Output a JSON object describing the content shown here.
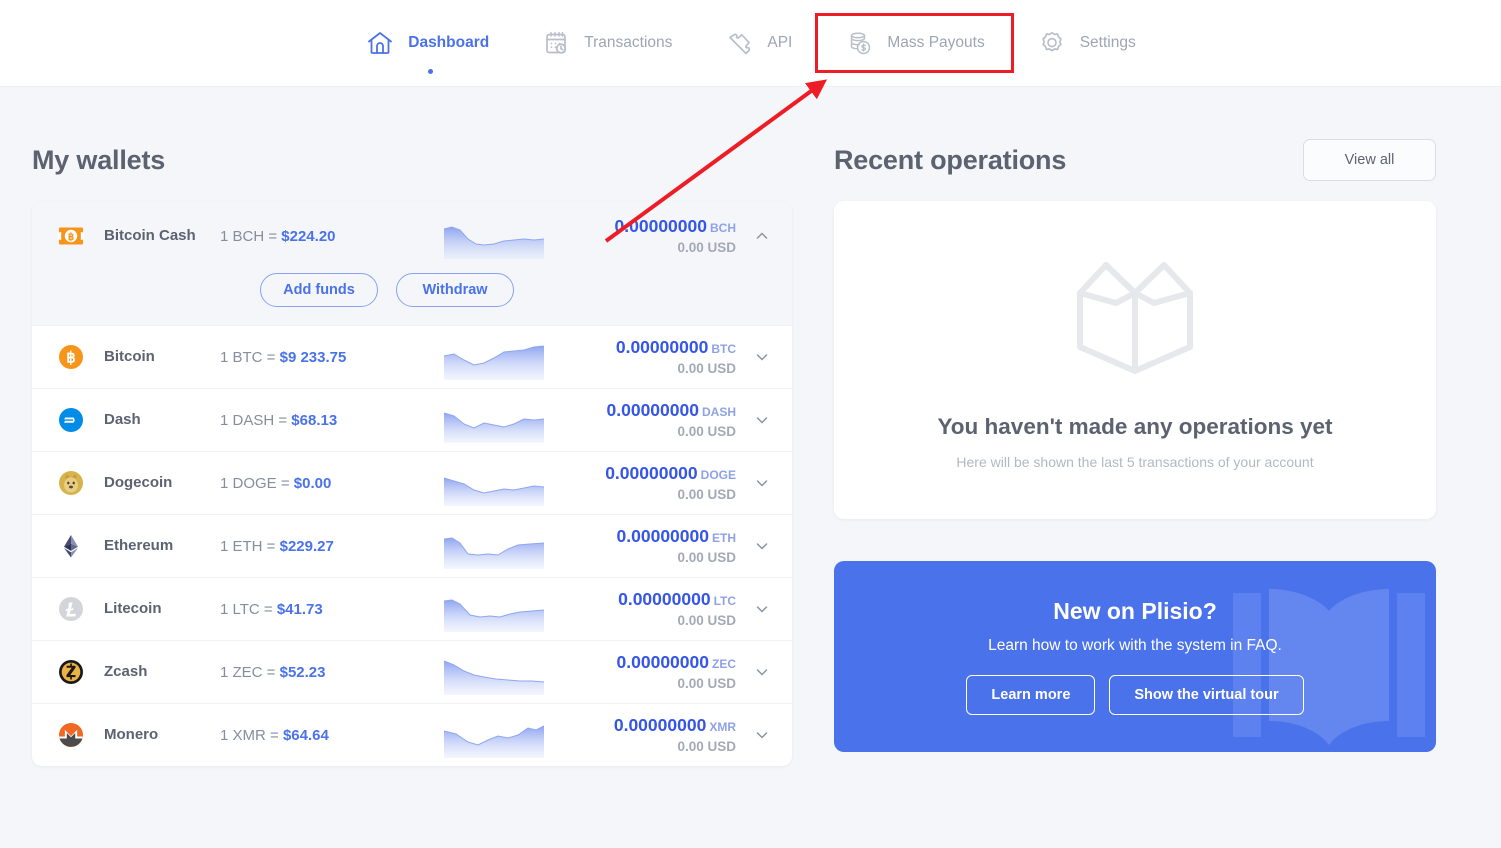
{
  "nav": {
    "items": [
      {
        "label": "Dashboard",
        "icon": "home-icon",
        "active": true,
        "highlighted": false
      },
      {
        "label": "Transactions",
        "icon": "calendar-clock-icon",
        "active": false,
        "highlighted": false
      },
      {
        "label": "API",
        "icon": "puzzle-piece-icon",
        "active": false,
        "highlighted": false
      },
      {
        "label": "Mass Payouts",
        "icon": "coins-dollar-icon",
        "active": false,
        "highlighted": true
      },
      {
        "label": "Settings",
        "icon": "gear-icon",
        "active": false,
        "highlighted": false
      }
    ]
  },
  "wallets_section": {
    "title": "My wallets",
    "expanded_actions": {
      "add_funds_label": "Add funds",
      "withdraw_label": "Withdraw"
    },
    "items": [
      {
        "name": "Bitcoin Cash",
        "icon": "bitcoin-cash-icon",
        "rate_prefix": "1 BCH =",
        "rate_value": "$224.20",
        "balance": "0.00000000",
        "ticker": "BCH",
        "usd": "0.00 USD",
        "expanded": true,
        "chevron": "chevron-up-icon"
      },
      {
        "name": "Bitcoin",
        "icon": "bitcoin-icon",
        "rate_prefix": "1 BTC =",
        "rate_value": "$9 233.75",
        "balance": "0.00000000",
        "ticker": "BTC",
        "usd": "0.00 USD",
        "expanded": false,
        "chevron": "chevron-down-icon"
      },
      {
        "name": "Dash",
        "icon": "dash-icon",
        "rate_prefix": "1 DASH =",
        "rate_value": "$68.13",
        "balance": "0.00000000",
        "ticker": "DASH",
        "usd": "0.00 USD",
        "expanded": false,
        "chevron": "chevron-down-icon"
      },
      {
        "name": "Dogecoin",
        "icon": "dogecoin-icon",
        "rate_prefix": "1 DOGE =",
        "rate_value": "$0.00",
        "balance": "0.00000000",
        "ticker": "DOGE",
        "usd": "0.00 USD",
        "expanded": false,
        "chevron": "chevron-down-icon"
      },
      {
        "name": "Ethereum",
        "icon": "ethereum-icon",
        "rate_prefix": "1 ETH =",
        "rate_value": "$229.27",
        "balance": "0.00000000",
        "ticker": "ETH",
        "usd": "0.00 USD",
        "expanded": false,
        "chevron": "chevron-down-icon"
      },
      {
        "name": "Litecoin",
        "icon": "litecoin-icon",
        "rate_prefix": "1 LTC =",
        "rate_value": "$41.73",
        "balance": "0.00000000",
        "ticker": "LTC",
        "usd": "0.00 USD",
        "expanded": false,
        "chevron": "chevron-down-icon"
      },
      {
        "name": "Zcash",
        "icon": "zcash-icon",
        "rate_prefix": "1 ZEC =",
        "rate_value": "$52.23",
        "balance": "0.00000000",
        "ticker": "ZEC",
        "usd": "0.00 USD",
        "expanded": false,
        "chevron": "chevron-down-icon"
      },
      {
        "name": "Monero",
        "icon": "monero-icon",
        "rate_prefix": "1 XMR =",
        "rate_value": "$64.64",
        "balance": "0.00000000",
        "ticker": "XMR",
        "usd": "0.00 USD",
        "expanded": false,
        "chevron": "chevron-down-icon"
      }
    ]
  },
  "operations_section": {
    "title": "Recent operations",
    "view_all_label": "View all",
    "empty_title": "You haven't made any operations yet",
    "empty_subtitle": "Here will be shown the last 5 transactions of your account",
    "empty_icon": "open-box-icon"
  },
  "promo": {
    "title": "New on Plisio?",
    "subtitle": "Learn how to work with the system in FAQ.",
    "learn_more_label": "Learn more",
    "virtual_tour_label": "Show the virtual tour",
    "watermark_icon": "open-book-icon"
  },
  "annotation": {
    "type": "arrow-and-box",
    "color": "#ee1c24",
    "target": "Mass Payouts"
  },
  "colors": {
    "accent_blue": "#4a72ea",
    "balance_blue": "#3656e8",
    "page_bg": "#f4f6fa",
    "text_dark": "#5c6270",
    "text_muted": "#a3a9b6",
    "annotation_red": "#ee1c24"
  }
}
